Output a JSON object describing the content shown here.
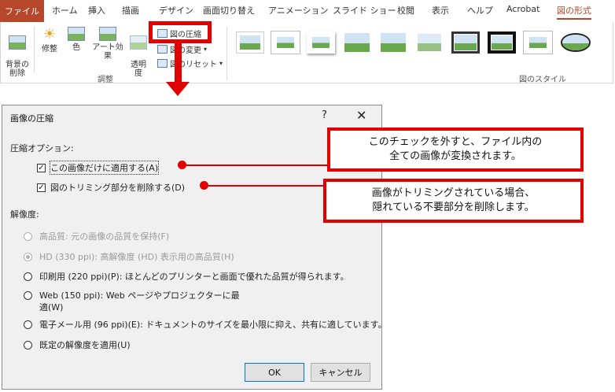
{
  "ribbon": {
    "tabs": [
      "ファイル",
      "ホーム",
      "挿入",
      "描画",
      "デザイン",
      "画面切り替え",
      "アニメーション",
      "スライド ショー",
      "校閲",
      "表示",
      "ヘルプ",
      "Acrobat",
      "図の形式"
    ],
    "adjust": {
      "remove_background": "背景の\n削除",
      "corrections": "修整",
      "color": "色",
      "artistic_effects": "アート効果",
      "transparency": "透明\n度",
      "compress": "図の圧縮",
      "change": "図の変更",
      "reset": "図のリセット",
      "group_label": "調整"
    },
    "styles_group_label": "図のスタイル"
  },
  "dialog": {
    "title": "画像の圧縮",
    "help": "?",
    "close": "✕",
    "compression_label": "圧縮オプション:",
    "apply_only_this": "この画像だけに適用する(A)",
    "delete_cropped": "図のトリミング部分を削除する(D)",
    "resolution_label": "解像度:",
    "options": [
      "高品質: 元の画像の品質を保持(F)",
      "HD (330 ppi): 高解像度 (HD) 表示用の高品質(H)",
      "印刷用 (220 ppi)(P): ほとんどのプリンターと画面で優れた品質が得られます。",
      "Web (150 ppi): Web ページやプロジェクターに最",
      "適(W)",
      "電子メール用 (96 ppi)(E): ドキュメントのサイズを最小限に抑え、共有に適しています。",
      "既定の解像度を適用(U)"
    ],
    "ok": "OK",
    "cancel": "キャンセル"
  },
  "callouts": {
    "one_l1": "このチェックを外すと、ファイル内の",
    "one_l2": "全ての画像が変換されます。",
    "two_l1": "画像がトリミングされている場合、",
    "two_l2": "隠れている不要部分を削除します。"
  },
  "colors": {
    "accent": "#b7472a",
    "highlight": "#e00000",
    "dialog_bg": "#f0f0f0"
  }
}
